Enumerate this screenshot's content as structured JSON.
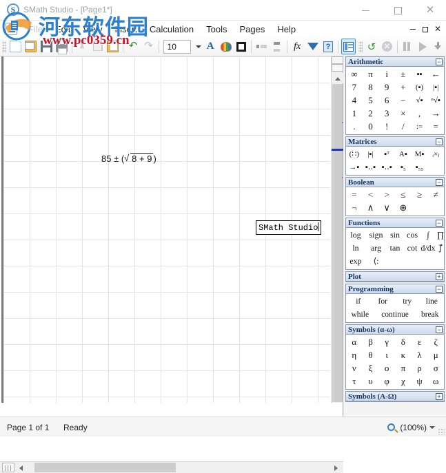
{
  "window": {
    "title": "SMath Studio - [Page1*]",
    "app_icon": "smath-logo-icon",
    "controls": {
      "minimize": "—",
      "maximize": "□",
      "close": "✕"
    }
  },
  "inner_window": {
    "controls": {
      "minimize": "—",
      "maximize": "□",
      "close": "✕"
    }
  },
  "menu": {
    "items": [
      {
        "label": "File"
      },
      {
        "label": "Edit"
      },
      {
        "label": "View"
      },
      {
        "label": "Insert"
      },
      {
        "label": "Calculation"
      },
      {
        "label": "Tools"
      },
      {
        "label": "Pages"
      },
      {
        "label": "Help"
      }
    ]
  },
  "toolbar": {
    "font_size": "10",
    "buttons": [
      {
        "name": "new-document-button",
        "tooltip": "New"
      },
      {
        "name": "open-document-button",
        "tooltip": "Open"
      },
      {
        "name": "save-document-button",
        "tooltip": "Save"
      },
      {
        "name": "print-button",
        "tooltip": "Print"
      },
      {
        "name": "cut-button",
        "tooltip": "Cut"
      },
      {
        "name": "copy-button",
        "tooltip": "Copy"
      },
      {
        "name": "paste-button",
        "tooltip": "Paste"
      },
      {
        "name": "undo-button",
        "tooltip": "Undo"
      },
      {
        "name": "redo-button",
        "tooltip": "Redo"
      },
      {
        "name": "font-color-button",
        "tooltip": "Font color"
      },
      {
        "name": "background-color-button",
        "tooltip": "Background color"
      },
      {
        "name": "border-button",
        "tooltip": "Border"
      },
      {
        "name": "align-horizontal-button",
        "tooltip": "Align horizontally"
      },
      {
        "name": "align-vertical-button",
        "tooltip": "Align vertically"
      },
      {
        "name": "function-button",
        "tooltip": "Insert function"
      },
      {
        "name": "unit-button",
        "tooltip": "Insert unit"
      },
      {
        "name": "reference-button",
        "tooltip": "Reference"
      },
      {
        "name": "side-panel-button",
        "tooltip": "Show panel"
      },
      {
        "name": "recalculate-button",
        "tooltip": "Recalculate"
      },
      {
        "name": "interrupt-button",
        "tooltip": "Interrupt"
      },
      {
        "name": "pause-button",
        "tooltip": "Pause"
      },
      {
        "name": "run-button",
        "tooltip": "Run"
      },
      {
        "name": "step-button",
        "tooltip": "Step"
      }
    ]
  },
  "canvas": {
    "expression": {
      "prefix": "85 ± (",
      "radical": "√",
      "radicand": "8 + 9",
      "suffix": ")"
    },
    "textbox": {
      "value": "SMath Studio"
    }
  },
  "palette": {
    "groups": [
      {
        "title": "Arithmetic",
        "toggle": "−",
        "rows": [
          [
            "∞",
            "π",
            "i",
            "±",
            "▪▪",
            "←"
          ],
          [
            "7",
            "8",
            "9",
            "+",
            "(▪)",
            "|▪|"
          ],
          [
            "4",
            "5",
            "6",
            "−",
            "√▪",
            "ⁿ√▪"
          ],
          [
            "1",
            "2",
            "3",
            "×",
            ",",
            "→"
          ],
          [
            ".",
            "0",
            "!",
            "/",
            ":=",
            "="
          ]
        ]
      },
      {
        "title": "Matrices",
        "toggle": "−",
        "rows": [
          [
            "(∷)",
            "|▪|",
            "▪ᵀ",
            "A▪",
            "M▪",
            "ᵢ×ⱼ"
          ],
          [
            "→▪",
            "▪‥▪",
            "▪‥▪",
            "▪₅",
            "▪₅₅",
            ""
          ]
        ]
      },
      {
        "title": "Boolean",
        "toggle": "−",
        "rows": [
          [
            "=",
            "<",
            ">",
            "≤",
            "≥",
            "≠"
          ],
          [
            "¬",
            "∧",
            "∨",
            "⊕",
            "",
            ""
          ]
        ]
      },
      {
        "title": "Functions",
        "toggle": "−",
        "rows": [
          [
            "log",
            "sign",
            "sin",
            "cos",
            "∫",
            "∏"
          ],
          [
            "ln",
            "arg",
            "tan",
            "cot",
            "d/dx",
            "∫⃗"
          ],
          [
            "exp",
            "⟨:",
            "",
            "",
            "",
            ""
          ]
        ]
      },
      {
        "title": "Plot",
        "toggle": "+",
        "rows": []
      },
      {
        "title": "Programming",
        "toggle": "−",
        "rows": [
          [
            "if",
            "for",
            "try",
            "line"
          ],
          [
            "while",
            "continue",
            "break"
          ]
        ]
      },
      {
        "title": "Symbols (α-ω)",
        "toggle": "−",
        "rows": [
          [
            "α",
            "β",
            "γ",
            "δ",
            "ε",
            "ζ"
          ],
          [
            "η",
            "θ",
            "ι",
            "κ",
            "λ",
            "μ"
          ],
          [
            "ν",
            "ξ",
            "ο",
            "π",
            "ρ",
            "σ"
          ],
          [
            "τ",
            "υ",
            "φ",
            "χ",
            "ψ",
            "ω"
          ]
        ]
      },
      {
        "title": "Symbols (A-Ω)",
        "toggle": "+",
        "rows": []
      }
    ]
  },
  "statusbar": {
    "page": "Page 1 of 1",
    "state": "Ready",
    "zoom": "(100%)"
  },
  "watermark": {
    "text_cn": "河东软件园",
    "url": "www.pc0359.cn"
  }
}
